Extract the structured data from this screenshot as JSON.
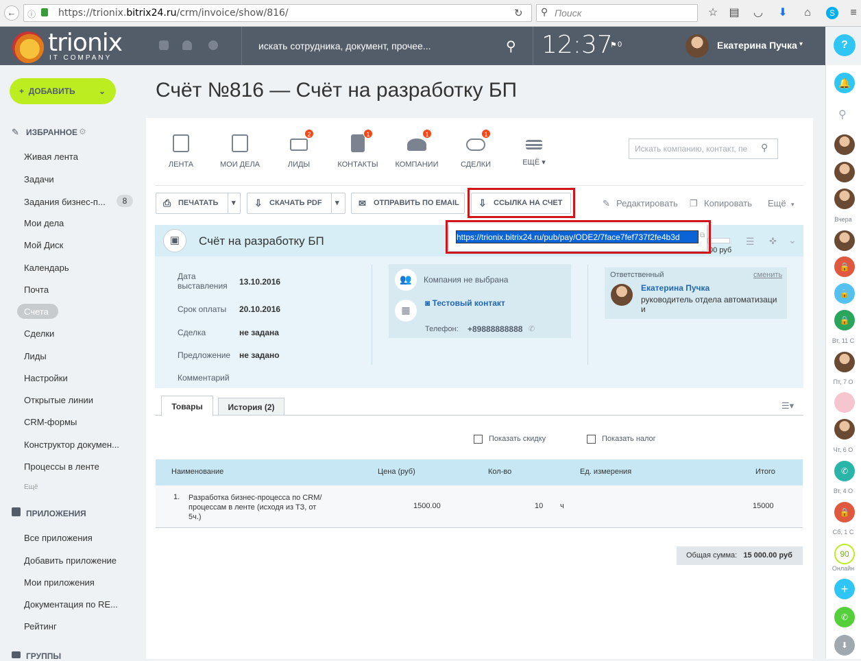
{
  "browser": {
    "url_prefix": "https://trionix.",
    "url_domain": "bitrix24.ru",
    "url_path": "/crm/invoice/show/816/",
    "search_placeholder": "Поиск"
  },
  "header": {
    "logo_text": "trionix",
    "logo_sub": "IT COMPANY",
    "search_placeholder": "искать сотрудника, документ, прочее...",
    "clock": "12:37",
    "flag_count": "0",
    "user_name": "Екатерина Пучка",
    "help": "?"
  },
  "sidebar": {
    "add_label": "ДОБАВИТЬ",
    "favorites_title": "ИЗБРАННОЕ",
    "items": [
      "Живая лента",
      "Задачи",
      "Задания бизнес-п...",
      "Мои дела",
      "Мой Диск",
      "Календарь",
      "Почта",
      "Счета",
      "Сделки",
      "Лиды",
      "Настройки",
      "Открытые линии",
      "CRM-формы",
      "Конструктор докумен...",
      "Процессы в ленте"
    ],
    "badge": "8",
    "more": "Ещё",
    "apps_title": "ПРИЛОЖЕНИЯ",
    "apps": [
      "Все приложения",
      "Добавить приложение",
      "Мои приложения",
      "Документация по RE...",
      "Рейтинг"
    ],
    "groups_title": "ГРУППЫ"
  },
  "page": {
    "title": "Счёт №816 — Счёт на разработку БП"
  },
  "toolbar": {
    "items": [
      {
        "label": "ЛЕНТА",
        "badge": ""
      },
      {
        "label": "МОИ ДЕЛА",
        "badge": ""
      },
      {
        "label": "ЛИДЫ",
        "badge": "2"
      },
      {
        "label": "КОНТАКТЫ",
        "badge": "1"
      },
      {
        "label": "КОМПАНИИ",
        "badge": "1"
      },
      {
        "label": "СДЕЛКИ",
        "badge": "1"
      },
      {
        "label": "ЕЩЁ",
        "badge": ""
      }
    ],
    "search_placeholder": "Искать компанию, контакт, пе"
  },
  "actions": {
    "print": "ПЕЧАТАТЬ",
    "pdf": "СКАЧАТЬ PDF",
    "email": "ОТПРАВИТЬ ПО EMAIL",
    "link": "ССЫЛКА НА СЧЕТ",
    "edit": "Редактировать",
    "copy": "Копировать",
    "more": "Ещё"
  },
  "invoice": {
    "title": "Счёт на разработку БП",
    "sum_fragment": "00 руб",
    "date_label": "Дата выставления",
    "date_value": "13.10.2016",
    "due_label": "Срок оплаты",
    "due_value": "20.10.2016",
    "deal_label": "Сделка",
    "deal_value": "не задана",
    "offer_label": "Предложение",
    "offer_value": "не задано",
    "comment_label": "Комментарий",
    "company": "Компания не выбрана",
    "contact": "Тестовый контакт",
    "phone_label": "Телефон:",
    "phone": "+89888888888",
    "resp_label": "Ответственный",
    "resp_change": "сменить",
    "resp_name": "Екатерина Пучка",
    "resp_role": "руководитель отдела автоматизаци и"
  },
  "tabs": [
    "Товары",
    "История (2)"
  ],
  "options": {
    "discount": "Показать скидку",
    "tax": "Показать налог"
  },
  "table": {
    "headers": [
      "Наименование",
      "Цена (руб)",
      "Кол-во",
      "Ед. измерения",
      "Итого"
    ],
    "row": {
      "num": "1.",
      "name": "Разработка бизнес-процесса по CRM/процессам в ленте (исходя из ТЗ, от 5ч.)",
      "price": "1500.00",
      "qty": "10",
      "unit": "ч",
      "total": "15000"
    },
    "total_label": "Общая сумма:",
    "total_value": "15 000.00 руб"
  },
  "popup": {
    "link": "https://trionix.bitrix24.ru/pub/pay/ODE2/7face7fef737f2fe4b3d"
  },
  "rightbar": {
    "labels": [
      "Вчера",
      "Вт, 11 С",
      "Пт, 7 О",
      "Чт, 6 О",
      "Вт, 4 О",
      "Сб, 1 С",
      "Онлайн"
    ],
    "online": "90"
  }
}
